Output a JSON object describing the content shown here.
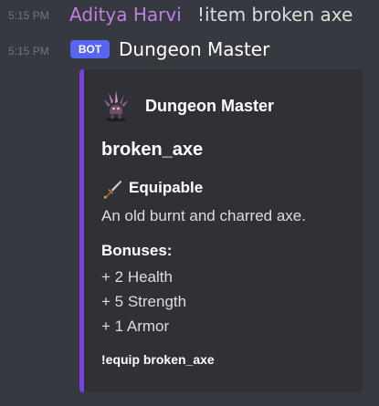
{
  "messages": [
    {
      "timestamp": "5:15 PM",
      "username": "Aditya Harvi",
      "text": "!item broken axe",
      "username_color": "#c27ee0"
    },
    {
      "timestamp": "5:15 PM",
      "badge": "BOT",
      "username": "Dungeon Master",
      "badge_color": "#5865f2"
    }
  ],
  "embed": {
    "accent_color": "#7b3fe4",
    "author": {
      "name": "Dungeon Master",
      "icon": "crystal-creature-icon"
    },
    "title": "broken_axe",
    "field": {
      "icon": "dagger-icon",
      "name": "Equipable",
      "value": "An old burnt and charred axe."
    },
    "bonuses": {
      "title": "Bonuses:",
      "items": [
        "+ 2 Health",
        "+ 5 Strength",
        "+ 1 Armor"
      ]
    },
    "footer": "!equip broken_axe"
  },
  "theme": {
    "background": "#36393f",
    "embed_background": "#2f3136"
  }
}
